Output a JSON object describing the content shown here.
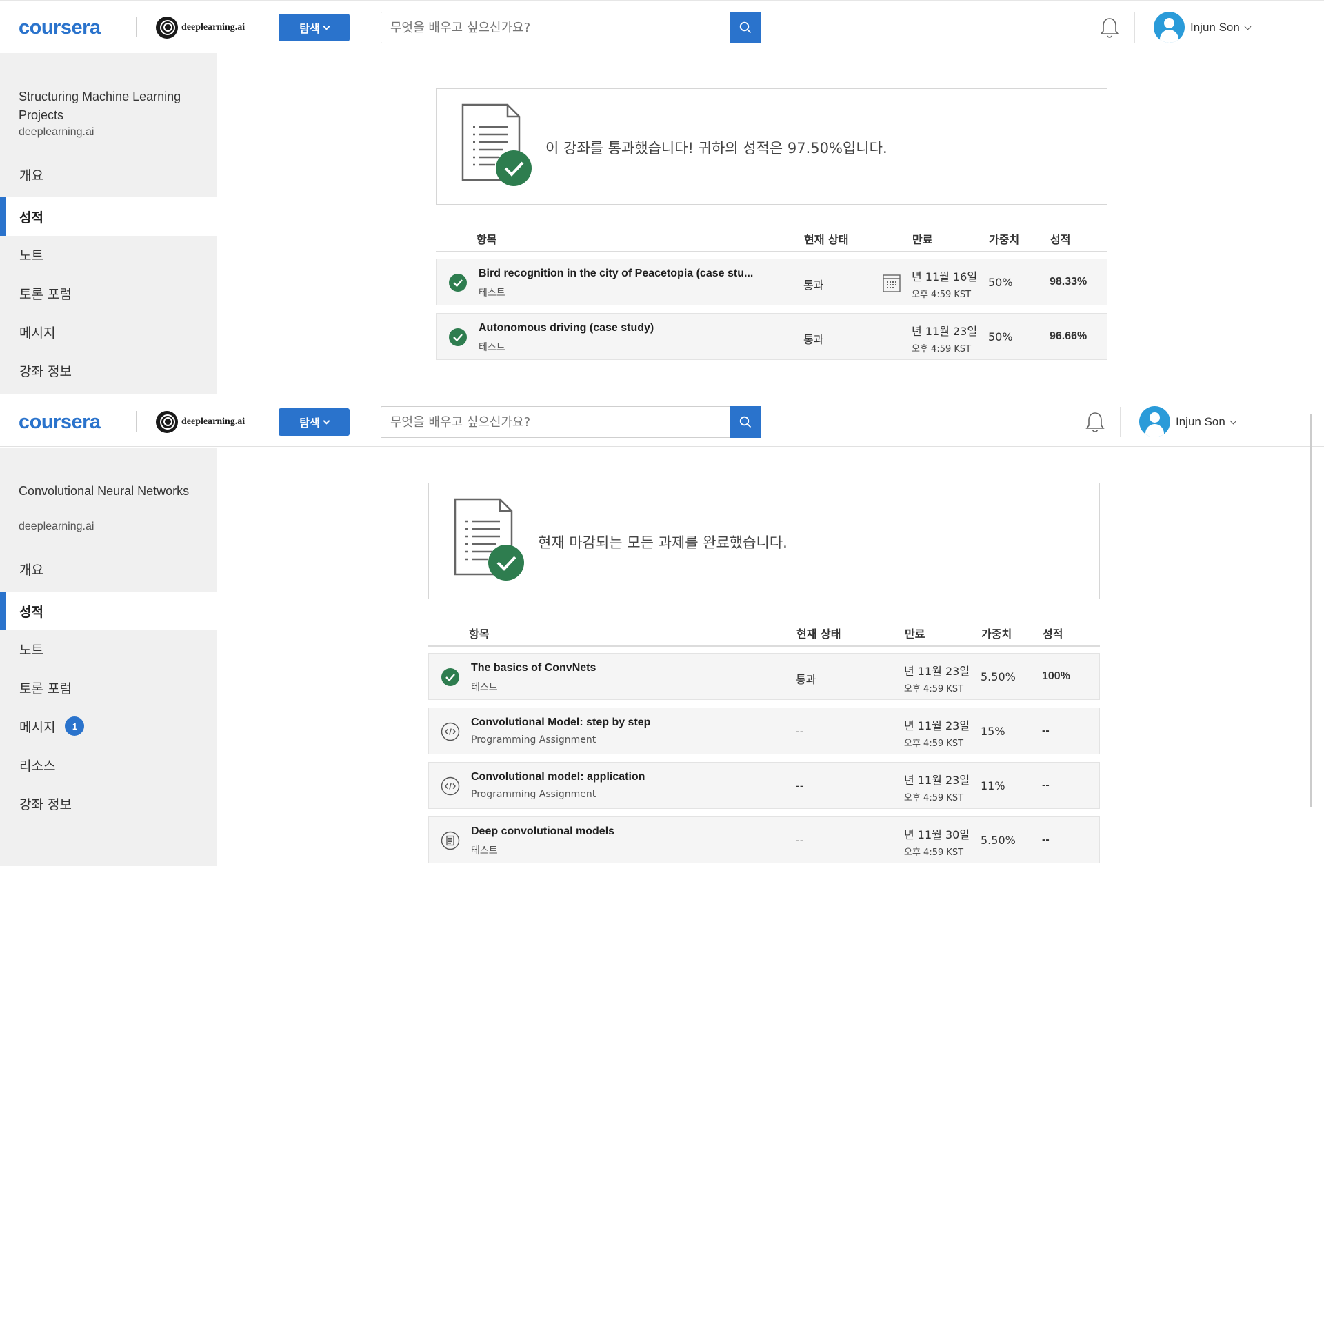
{
  "header": {
    "logo": "coursera",
    "partner": "deeplearning.ai",
    "explore_label": "탐색",
    "search_placeholder": "무엇을 배우고 싶으신가요?",
    "user_name": "Injun Son"
  },
  "colors": {
    "brand": "#2a73cc",
    "success": "#2e7d4f",
    "avatar": "#2a9bd9"
  },
  "panel1": {
    "course_title": "Structuring Machine Learning Projects",
    "course_partner": "deeplearning.ai",
    "nav": [
      "개요",
      "성적",
      "노트",
      "토론 포럼",
      "메시지",
      "강좌 정보"
    ],
    "active_nav": "성적",
    "summary": "이 강좌를 통과했습니다! 귀하의 성적은 97.50%입니다.",
    "columns": {
      "item": "항목",
      "status": "현재 상태",
      "due": "만료",
      "weight": "가중치",
      "grade": "성적"
    },
    "rows": [
      {
        "title": "Bird recognition in the city of Peacetopia (case stu...",
        "type": "테스트",
        "status": "통과",
        "due_date": "년 11월 16일",
        "due_time": "오후 4:59 KST",
        "weight": "50%",
        "grade": "98.33%",
        "icon": "check-circle-icon"
      },
      {
        "title": "Autonomous driving (case study)",
        "type": "테스트",
        "status": "통과",
        "due_date": "년 11월 23일",
        "due_time": "오후 4:59 KST",
        "weight": "50%",
        "grade": "96.66%",
        "icon": "check-circle-icon"
      }
    ]
  },
  "panel2": {
    "course_title": "Convolutional Neural Networks",
    "course_partner": "deeplearning.ai",
    "nav": [
      "개요",
      "성적",
      "노트",
      "토론 포럼",
      "메시지",
      "리소스",
      "강좌 정보"
    ],
    "active_nav": "성적",
    "message_badge": "1",
    "summary": "현재 마감되는 모든 과제를 완료했습니다.",
    "columns": {
      "item": "항목",
      "status": "현재 상태",
      "due": "만료",
      "weight": "가중치",
      "grade": "성적"
    },
    "rows": [
      {
        "title": "The basics of ConvNets",
        "type": "테스트",
        "status": "통과",
        "due_date": "년 11월 23일",
        "due_time": "오후 4:59 KST",
        "weight": "5.50%",
        "grade": "100%",
        "icon": "check-circle-icon"
      },
      {
        "title": "Convolutional Model: step by step",
        "type": "Programming Assignment",
        "status": "--",
        "due_date": "년 11월 23일",
        "due_time": "오후 4:59 KST",
        "weight": "15%",
        "grade": "--",
        "icon": "code-icon"
      },
      {
        "title": "Convolutional model: application",
        "type": "Programming Assignment",
        "status": "--",
        "due_date": "년 11월 23일",
        "due_time": "오후 4:59 KST",
        "weight": "11%",
        "grade": "--",
        "icon": "code-icon"
      },
      {
        "title": "Deep convolutional models",
        "type": "테스트",
        "status": "--",
        "due_date": "년 11월 30일",
        "due_time": "오후 4:59 KST",
        "weight": "5.50%",
        "grade": "--",
        "icon": "quiz-icon"
      }
    ]
  }
}
